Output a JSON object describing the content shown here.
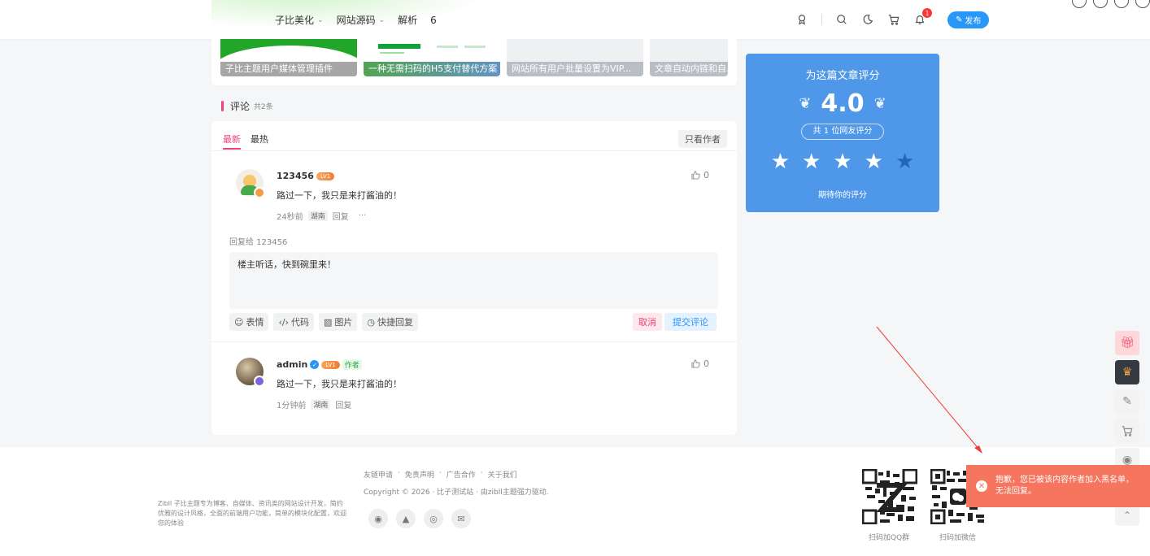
{
  "header": {
    "nav": [
      {
        "label": "子比美化",
        "has_dropdown": true
      },
      {
        "label": "网站源码",
        "has_dropdown": true
      },
      {
        "label": "解析",
        "has_dropdown": false
      },
      {
        "label": "6",
        "has_dropdown": false
      }
    ],
    "notification_count": "1",
    "publish_label": "发布"
  },
  "related_posts": [
    {
      "title": "子比主题用户媒体管理插件"
    },
    {
      "title": "一种无需扫码的H5支付替代方案"
    },
    {
      "title": "网站所有用户批量设置为VIP..."
    },
    {
      "title": "文章自动内链和自..."
    }
  ],
  "comments": {
    "heading": "评论",
    "count_label": "共2条",
    "tabs": [
      "最新",
      "最热"
    ],
    "author_only_label": "只看作者",
    "items": [
      {
        "name": "123456",
        "level": "LV1",
        "text": "路过一下，我只是来打酱油的！",
        "time": "24秒前",
        "region": "湖南",
        "reply_label": "回复",
        "more": "···",
        "likes": "0"
      },
      {
        "name": "admin",
        "level": "LV1",
        "author_tag": "作者",
        "text": "路过一下，我只是来打酱油的！",
        "time": "1分钟前",
        "region": "湖南",
        "reply_label": "回复",
        "likes": "0"
      }
    ],
    "reply_to": "回复给 123456",
    "reply_value": "楼主听话，快到碗里来！",
    "tools": [
      "表情",
      "代码",
      "图片",
      "快捷回复"
    ],
    "cancel_label": "取消",
    "submit_label": "提交评论"
  },
  "rating": {
    "title": "为这篇文章评分",
    "score": "4.0",
    "count_label": "共 1 位网友评分",
    "stars_filled": 4,
    "stars_total": 5,
    "hint": "期待你的评分"
  },
  "toast": {
    "message": "抱歉，您已被该内容作者加入黑名单，无法回复。"
  },
  "footer": {
    "description": "Zibll 子比主题专为博客、自媒体、资讯类的网站设计开发，简约优雅的设计风格，全面的前端用户功能，简单的模块化配置，欢迎您的体验",
    "links": [
      "友链申请",
      "免责声明",
      "广告合作",
      "关于我们"
    ],
    "copyright": "Copyright © 2026 · 比子测试站 · 由zibll主题强力驱动.",
    "qr_labels": [
      "扫码加QQ群",
      "扫码加微信"
    ]
  },
  "colors": {
    "accent_pink": "#f0427a",
    "accent_blue": "#2997f7",
    "rating_bg": "#4f97e8",
    "toast_bg": "#f5755f"
  }
}
